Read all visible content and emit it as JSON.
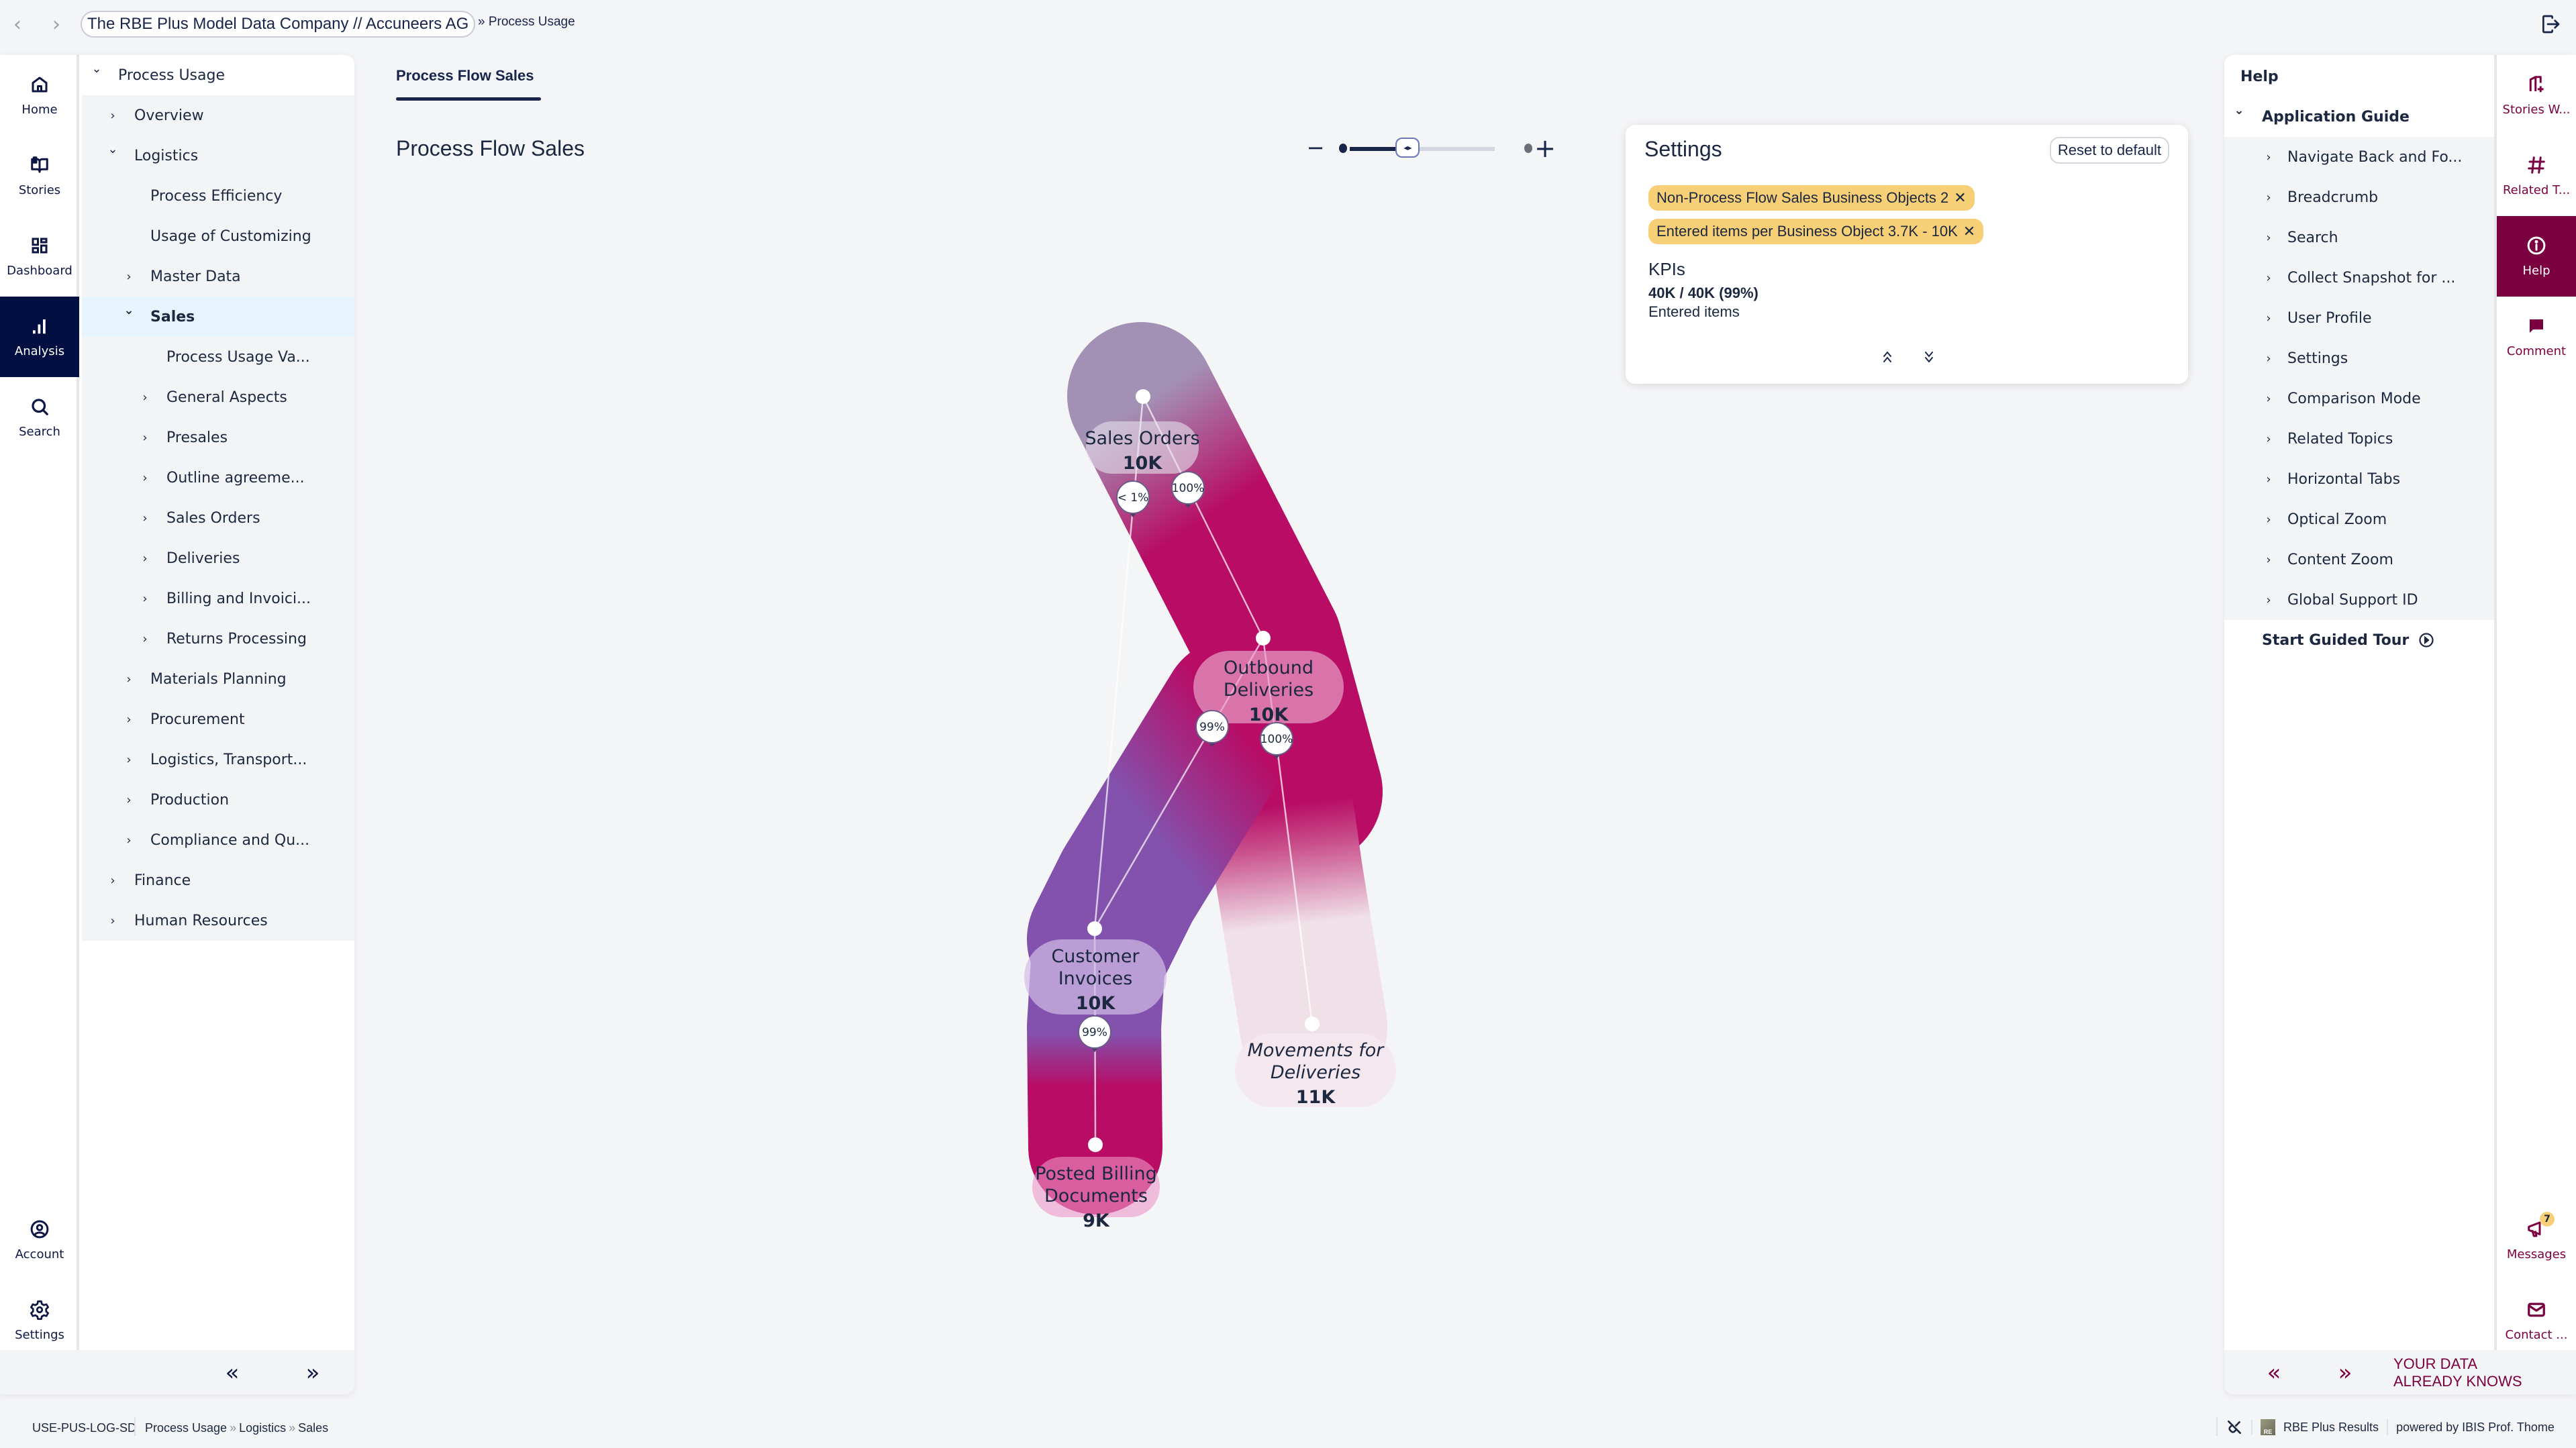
{
  "topbar": {
    "back_icon": "chevron-left-icon",
    "forward_icon": "chevron-right-icon",
    "company": "The RBE Plus Model Data Company // Accuneers AG",
    "breadcrumb": "» Process Usage",
    "logout_icon": "logout-icon"
  },
  "left_rail": {
    "items": [
      {
        "label": "Home",
        "icon": "home-icon",
        "active": false
      },
      {
        "label": "Stories",
        "icon": "book-open-icon",
        "active": false
      },
      {
        "label": "Dashboard",
        "icon": "dashboard-grid-icon",
        "active": false
      },
      {
        "label": "Analysis",
        "icon": "bar-chart-icon",
        "active": true
      },
      {
        "label": "Search",
        "icon": "search-icon",
        "active": false
      }
    ],
    "bottom_items": [
      {
        "label": "Account",
        "icon": "user-circle-icon"
      },
      {
        "label": "Settings",
        "icon": "gear-icon"
      }
    ]
  },
  "tree": {
    "items": [
      {
        "label": "Process Usage",
        "level": 0,
        "expanded": true,
        "has_children": true
      },
      {
        "label": "Overview",
        "level": 1,
        "expanded": false,
        "has_children": true
      },
      {
        "label": "Logistics",
        "level": 1,
        "expanded": true,
        "has_children": true
      },
      {
        "label": "Process Efficiency",
        "level": 2,
        "has_children": false
      },
      {
        "label": "Usage of Customizing",
        "level": 2,
        "has_children": false
      },
      {
        "label": "Master Data",
        "level": 2,
        "expanded": false,
        "has_children": true
      },
      {
        "label": "Sales",
        "level": 2,
        "expanded": true,
        "has_children": true,
        "selected": true
      },
      {
        "label": "Process Usage Va...",
        "level": 3,
        "has_children": false
      },
      {
        "label": "General Aspects",
        "level": 3,
        "expanded": false,
        "has_children": true
      },
      {
        "label": "Presales",
        "level": 3,
        "expanded": false,
        "has_children": true
      },
      {
        "label": "Outline agreeme...",
        "level": 3,
        "expanded": false,
        "has_children": true
      },
      {
        "label": "Sales Orders",
        "level": 3,
        "expanded": false,
        "has_children": true
      },
      {
        "label": "Deliveries",
        "level": 3,
        "expanded": false,
        "has_children": true
      },
      {
        "label": "Billing and Invoici...",
        "level": 3,
        "expanded": false,
        "has_children": true
      },
      {
        "label": "Returns Processing",
        "level": 3,
        "expanded": false,
        "has_children": true
      },
      {
        "label": "Materials Planning",
        "level": 2,
        "expanded": false,
        "has_children": true
      },
      {
        "label": "Procurement",
        "level": 2,
        "expanded": false,
        "has_children": true
      },
      {
        "label": "Logistics, Transport...",
        "level": 2,
        "expanded": false,
        "has_children": true
      },
      {
        "label": "Production",
        "level": 2,
        "expanded": false,
        "has_children": true
      },
      {
        "label": "Compliance and Qu...",
        "level": 2,
        "expanded": false,
        "has_children": true
      },
      {
        "label": "Finance",
        "level": 1,
        "expanded": false,
        "has_children": true
      },
      {
        "label": "Human Resources",
        "level": 1,
        "expanded": false,
        "has_children": true
      }
    ],
    "collapse_label": "«",
    "expand_label": "»"
  },
  "main": {
    "tab": "Process Flow Sales",
    "title": "Process Flow Sales",
    "zoom": {
      "minus": "−",
      "plus": "+",
      "level_fraction": 0.4
    }
  },
  "settings": {
    "title": "Settings",
    "reset_label": "Reset to default",
    "chips": [
      {
        "label": "Non-Process Flow Sales Business Objects 2",
        "remove": "✕"
      },
      {
        "label": "Entered items per Business Object 3.7K - 10K",
        "remove": "✕"
      }
    ],
    "kpi_title": "KPIs",
    "kpi_value": "40K / 40K (99%)",
    "kpi_label": "Entered items",
    "collapse_icon": "double-chevron-up-icon",
    "expand_icon": "double-chevron-down-icon"
  },
  "flow": {
    "nodes": [
      {
        "id": "sales_orders",
        "lines": [
          "Sales Orders"
        ],
        "value": "10K",
        "italic": false
      },
      {
        "id": "outbound_deliveries",
        "lines": [
          "Outbound",
          "Deliveries"
        ],
        "value": "10K",
        "italic": false
      },
      {
        "id": "customer_invoices",
        "lines": [
          "Customer",
          "Invoices"
        ],
        "value": "10K",
        "italic": false
      },
      {
        "id": "posted_billing",
        "lines": [
          "Posted Billing",
          "Documents"
        ],
        "value": "9K",
        "italic": false
      },
      {
        "id": "movements_deliveries",
        "lines": [
          "Movements for",
          "Deliveries"
        ],
        "value": "11K",
        "italic": true
      }
    ],
    "edges": [
      {
        "from": "sales_orders",
        "to": "customer_invoices",
        "label": "< 1%"
      },
      {
        "from": "sales_orders",
        "to": "outbound_deliveries",
        "label": "100%"
      },
      {
        "from": "outbound_deliveries",
        "to": "customer_invoices",
        "label": "99%"
      },
      {
        "from": "outbound_deliveries",
        "to": "movements_deliveries",
        "label": "100%"
      },
      {
        "from": "customer_invoices",
        "to": "posted_billing",
        "label": "99%"
      }
    ],
    "colors": {
      "sales_orders": "#a391b5",
      "outbound_deliveries": "#b80c65",
      "customer_invoices": "#8352ad",
      "posted_billing": "#b80c65",
      "movements_deliveries": "#f0e1e8"
    }
  },
  "help": {
    "title": "Help",
    "section": "Application Guide",
    "items": [
      "Navigate Back and Fo...",
      "Breadcrumb",
      "Search",
      "Collect Snapshot for ...",
      "User Profile",
      "Settings",
      "Comparison Mode",
      "Related Topics",
      "Horizontal Tabs",
      "Optical Zoom",
      "Content Zoom",
      "Global Support ID"
    ],
    "tour_label": "Start Guided Tour",
    "tour_icon": "play-circle-icon"
  },
  "right_rail": {
    "items": [
      {
        "label": "Stories W...",
        "icon": "story-add-icon",
        "active": false
      },
      {
        "label": "Related T...",
        "icon": "hashtag-icon",
        "active": false
      },
      {
        "label": "Help",
        "icon": "info-circle-icon",
        "active": true
      },
      {
        "label": "Comment",
        "icon": "comment-icon",
        "active": false
      }
    ],
    "bottom_items": [
      {
        "label": "Messages",
        "icon": "megaphone-icon",
        "badge": "7"
      },
      {
        "label": "Contact ...",
        "icon": "mail-icon"
      }
    ],
    "collapse_label": "«",
    "expand_label": "»",
    "tagline_line1": "YOUR DATA",
    "tagline_line2": "ALREADY KNOWS"
  },
  "statusbar": {
    "code": "USE-PUS-LOG-SD",
    "crumbs": [
      "Process Usage",
      "Logistics",
      "Sales"
    ],
    "crumb_sep": "»",
    "plug_icon": "disconnected-plug-icon",
    "product": "RBE Plus Results",
    "powered_by": "powered by IBIS Prof. Thome",
    "logo_text": "RE"
  },
  "colors": {
    "nav_dark": "#010f42",
    "accent_wine": "#7a0040",
    "chip_yellow": "#f6cf76",
    "selected_row": "#e8f4fd"
  }
}
